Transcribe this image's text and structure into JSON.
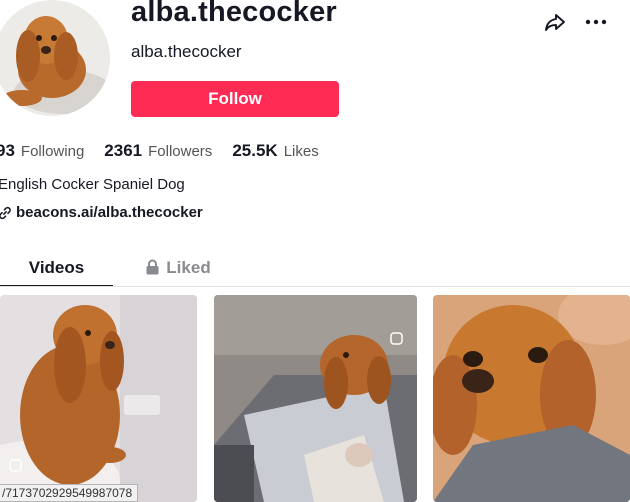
{
  "profile": {
    "username": "alba.thecocker",
    "nickname": "alba.thecocker",
    "follow_label": "Follow",
    "bio": "English Cocker Spaniel Dog",
    "link": "beacons.ai/alba.thecocker"
  },
  "stats": [
    {
      "value": "93",
      "label": "Following"
    },
    {
      "value": "2361",
      "label": "Followers"
    },
    {
      "value": "25.5K",
      "label": "Likes"
    }
  ],
  "tabs": [
    {
      "label": "Videos",
      "active": true
    },
    {
      "label": "Liked",
      "active": false,
      "icon": "lock-icon"
    }
  ],
  "status_url": "/7173702929549987078",
  "icons": [
    "share-icon",
    "more-icon",
    "link-icon",
    "lock-icon"
  ],
  "colors": {
    "follow_button": "#fe2c55",
    "text": "#161823",
    "muted": "#8a8b91"
  }
}
